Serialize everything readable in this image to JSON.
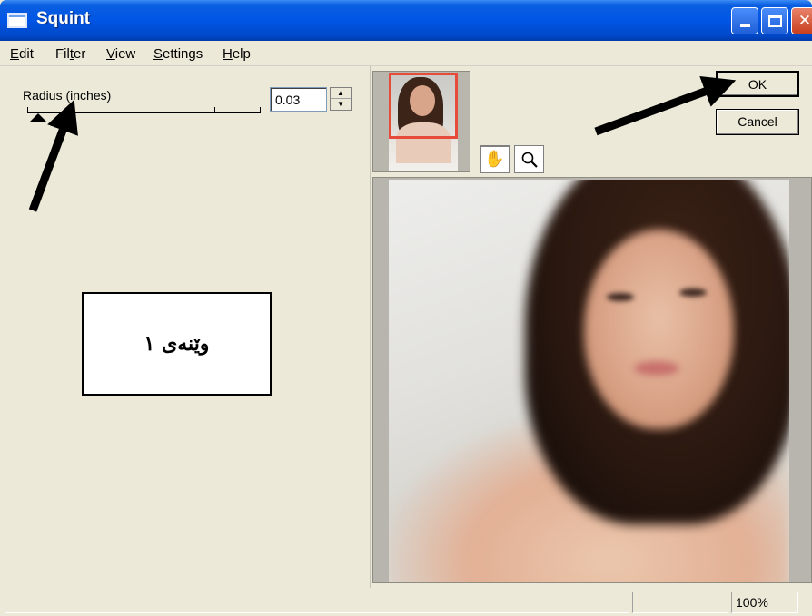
{
  "window": {
    "title": "Squint"
  },
  "menu": {
    "items": [
      {
        "label": "Edit",
        "mnemonic_index": 0
      },
      {
        "label": "Filter",
        "mnemonic_index": 3
      },
      {
        "label": "View",
        "mnemonic_index": 0
      },
      {
        "label": "Settings",
        "mnemonic_index": 0
      },
      {
        "label": "Help",
        "mnemonic_index": 0
      }
    ]
  },
  "controls": {
    "radius_label": "Radius (inches)",
    "radius_value": "0.03",
    "spin_up": "▲",
    "spin_down": "▼"
  },
  "buttons": {
    "ok": "OK",
    "cancel": "Cancel"
  },
  "tools": {
    "hand_icon": "hand-icon",
    "zoom_icon": "magnifier-icon"
  },
  "annotation": {
    "caption": "وێنەی ١"
  },
  "status": {
    "main": "",
    "middle": "",
    "zoom": "100%"
  },
  "colors": {
    "title_bar": "#0055e5",
    "window_bg": "#ece9d8",
    "thumbnail_highlight": "#e64b3c"
  }
}
